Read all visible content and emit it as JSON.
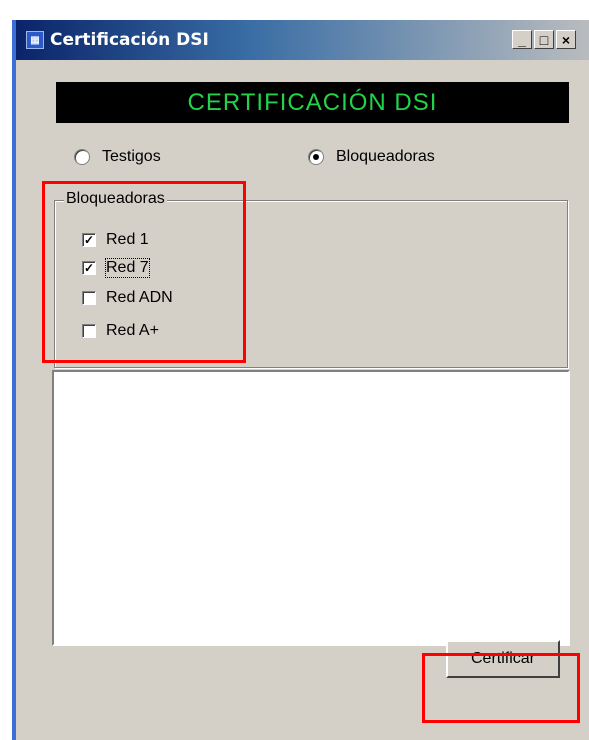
{
  "window": {
    "title": "Certificación DSI",
    "minimize_label": "_",
    "maximize_label": "□",
    "close_label": "×"
  },
  "banner": {
    "text": "CERTIFICACIÓN DSI"
  },
  "mode": {
    "options": [
      {
        "label": "Testigos",
        "selected": false
      },
      {
        "label": "Bloqueadoras",
        "selected": true
      }
    ]
  },
  "group": {
    "title": "Bloqueadoras",
    "items": [
      {
        "label": "Red 1",
        "checked": true
      },
      {
        "label": "Red 7",
        "checked": true
      },
      {
        "label": "Red ADN",
        "checked": false
      },
      {
        "label": "Red A+",
        "checked": false
      }
    ]
  },
  "output": {
    "value": ""
  },
  "actions": {
    "certify_label": "Certificar"
  },
  "highlight_color": "#ff0000",
  "accent_banner_text_color": "#22d34a"
}
